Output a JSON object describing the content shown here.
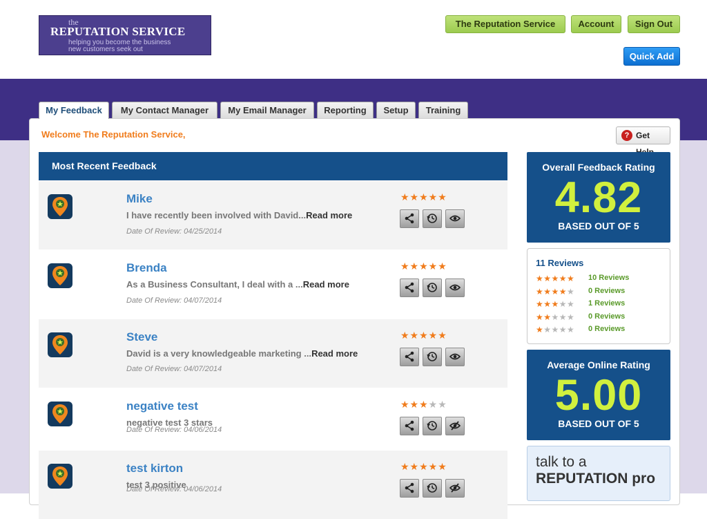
{
  "logo": {
    "the": "the",
    "name": "REPUTATION SERVICE",
    "tagline_1": "helping you become the business",
    "tagline_2": "new customers seek out"
  },
  "top_nav": {
    "buttons": [
      "The Reputation Service",
      "Account",
      "Sign Out"
    ],
    "quick_add": "Quick Add"
  },
  "tabs": [
    {
      "label": "My Feedback",
      "active": true
    },
    {
      "label": "My Contact Manager",
      "active": false
    },
    {
      "label": "My Email Manager",
      "active": false
    },
    {
      "label": "Reporting",
      "active": false
    },
    {
      "label": "Setup",
      "active": false
    },
    {
      "label": "Training",
      "active": false
    }
  ],
  "welcome": "Welcome The Reputation Service,",
  "get_help": "Get Help",
  "feedback": {
    "header": "Most Recent Feedback",
    "items": [
      {
        "name": "Mike",
        "text": "I have recently been involved with David...",
        "read_more": "Read more",
        "date": "Date Of Review: 04/25/2014",
        "stars": 5,
        "visible": true
      },
      {
        "name": "Brenda",
        "text": "As a Business Consultant, I deal with a ...",
        "read_more": "Read more",
        "date": "Date Of Review: 04/07/2014",
        "stars": 5,
        "visible": true
      },
      {
        "name": "Steve",
        "text": "David is a very knowledgeable marketing ...",
        "read_more": "Read more",
        "date": "Date Of Review: 04/07/2014",
        "stars": 5,
        "visible": true
      },
      {
        "name": "negative test",
        "text": "negative test 3 stars",
        "read_more": "",
        "date": "Date Of Review: 04/06/2014",
        "stars": 3,
        "visible": false
      },
      {
        "name": "test kirton",
        "text": "test 3 positive",
        "read_more": "",
        "date": "Date Of Review: 04/06/2014",
        "stars": 5,
        "visible": false
      }
    ]
  },
  "overall": {
    "title": "Overall Feedback Rating",
    "value": "4.82",
    "sub": "BASED OUT OF 5"
  },
  "reviews": {
    "title": "11 Reviews",
    "breakdown": [
      {
        "stars": 5,
        "count": "10 Reviews"
      },
      {
        "stars": 4,
        "count": "0 Reviews"
      },
      {
        "stars": 3,
        "count": "1 Reviews"
      },
      {
        "stars": 2,
        "count": "0 Reviews"
      },
      {
        "stars": 1,
        "count": "0 Reviews"
      }
    ]
  },
  "online": {
    "title": "Average Online Rating",
    "value": "5.00",
    "sub": "BASED OUT OF 5"
  },
  "talk": {
    "line1": "talk to a",
    "line2": "REPUTATION pro"
  },
  "colors": {
    "accent_orange": "#f07c1c",
    "header_blue": "#15508a",
    "rating_green": "#d1f03e",
    "nav_green": "#a8d35e",
    "purple": "#3e2f85"
  },
  "icons": {
    "share": "share-icon",
    "history": "history-icon",
    "visible": "eye-icon",
    "hidden": "eye-slash-icon",
    "location": "location-pin-icon",
    "help": "question-icon"
  }
}
